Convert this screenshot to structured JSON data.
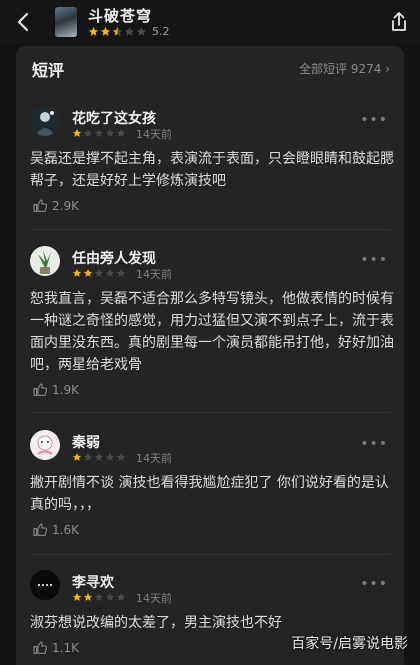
{
  "header": {
    "title": "斗破苍穹",
    "rating": "5.2",
    "rating_stars": 2.5
  },
  "section": {
    "title": "短评",
    "all_reviews_label": "全部短评 9274",
    "all_reviews_chevron": "›"
  },
  "comments": [
    {
      "username": "花吃了这女孩",
      "stars": 1,
      "time": "14天前",
      "text": "吴磊还是撑不起主角，表演流于表面，只会瞪眼睛和鼓起腮帮子，还是好好上学修炼演技吧",
      "likes": "2.9K"
    },
    {
      "username": "任由旁人发现",
      "stars": 2,
      "time": "14天前",
      "text": "恕我直言，吴磊不适合那么多特写镜头，他做表情的时候有一种谜之奇怪的感觉，用力过猛但又演不到点子上，流于表面内里没东西。真的剧里每一个演员都能吊打他，好好加油吧，两星给老戏骨",
      "likes": "1.9K"
    },
    {
      "username": "秦弱",
      "stars": 1,
      "time": "14天前",
      "text": "撇开剧情不谈 演技也看得我尴尬症犯了 你们说好看的是认真的吗，，，",
      "likes": "1.6K"
    },
    {
      "username": "李寻欢",
      "stars": 2,
      "time": "14天前",
      "text": "淑芬想说改编的太差了，男主演技也不好",
      "likes": "1.1K"
    }
  ],
  "more_label": "•••",
  "watermark": "百家号/启雾说电影",
  "colors": {
    "background": "#121212",
    "card": "#242424",
    "star_active": "#f5b400",
    "star_inactive": "#4a4a4a"
  }
}
